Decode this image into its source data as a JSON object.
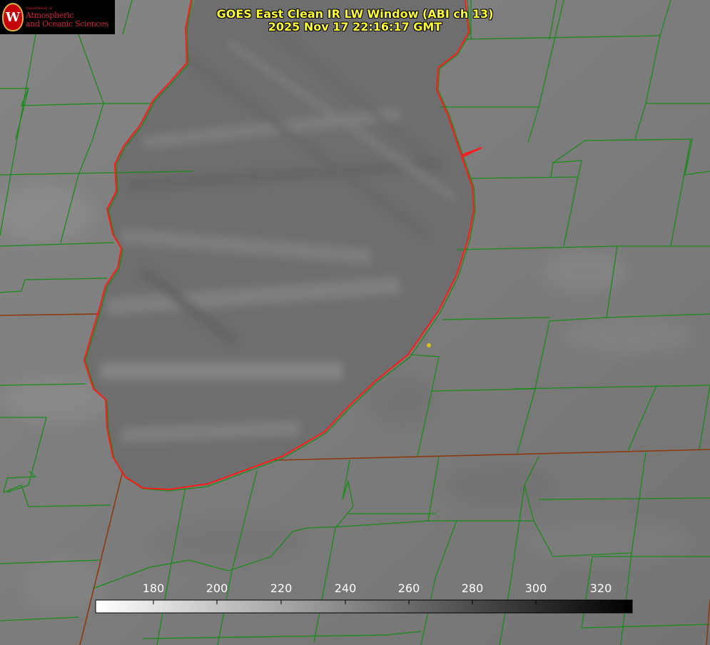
{
  "header": {
    "title_line1": "GOES East Clean IR LW Window (ABI ch 13)",
    "title_line2": "2025 Nov 17 22:16:17 GMT",
    "title_color": "#ffff33"
  },
  "logo": {
    "department": "Department of",
    "line1": "Atmospheric",
    "line2": "and Oceanic Sciences",
    "seal_letter": "W",
    "text_color": "#d0243a",
    "seal_color": "#c5050c"
  },
  "colorbar": {
    "ticks": [
      "180",
      "200",
      "220",
      "240",
      "260",
      "280",
      "300",
      "320"
    ],
    "gradient": [
      "#ffffff",
      "#000000"
    ]
  },
  "map": {
    "lake_outline_color": "#ff1a1a",
    "county_line_color": "#1a8a1a",
    "state_line_color": "#8b3a10",
    "marker_color": "#d4c21a"
  }
}
